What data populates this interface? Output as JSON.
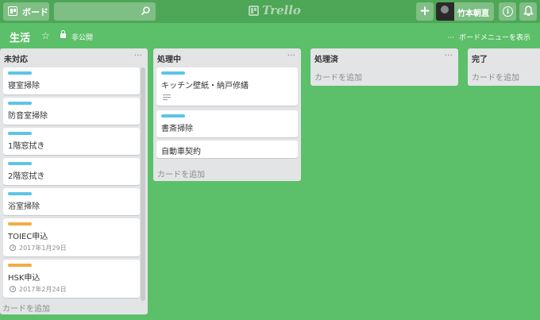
{
  "header": {
    "boards_label": "ボード",
    "search_value": "",
    "logo_text": "Trello",
    "add_label": "+",
    "user_name": "竹本朝直",
    "info_label": "i"
  },
  "board": {
    "title": "生活",
    "star": "☆",
    "privacy": "非公開",
    "menu_dots": "···",
    "menu_label": "ボードメニューを表示"
  },
  "colors": {
    "label_blue": "#5dc4e8",
    "label_orange": "#f5ab44"
  },
  "lists": [
    {
      "title": "未対応",
      "menu": "···",
      "add_card": "カードを追加",
      "cards": [
        {
          "label": "blue",
          "title": "寝室掃除"
        },
        {
          "label": "blue",
          "title": "防音室掃除"
        },
        {
          "label": "blue",
          "title": "1階窓拭き"
        },
        {
          "label": "blue",
          "title": "2階窓拭き"
        },
        {
          "label": "blue",
          "title": "浴室掃除"
        },
        {
          "label": "orange",
          "title": "TOIEC申込",
          "due": "2017年1月29日"
        },
        {
          "label": "orange",
          "title": "HSK申込",
          "due": "2017年2月24日"
        }
      ]
    },
    {
      "title": "処理中",
      "menu": "···",
      "add_card": "カードを追加",
      "cards": [
        {
          "label": "blue",
          "title": "キッチン壁紙・納戸修繕",
          "description_icon": "description-icon"
        },
        {
          "label": "blue",
          "title": "書斎掃除"
        },
        {
          "title": "自動車契約"
        }
      ]
    },
    {
      "title": "処理済",
      "menu": "···",
      "add_card": "カードを追加",
      "cards": []
    },
    {
      "title": "完了",
      "menu": "···",
      "add_card": "カードを追加",
      "cards": []
    }
  ]
}
